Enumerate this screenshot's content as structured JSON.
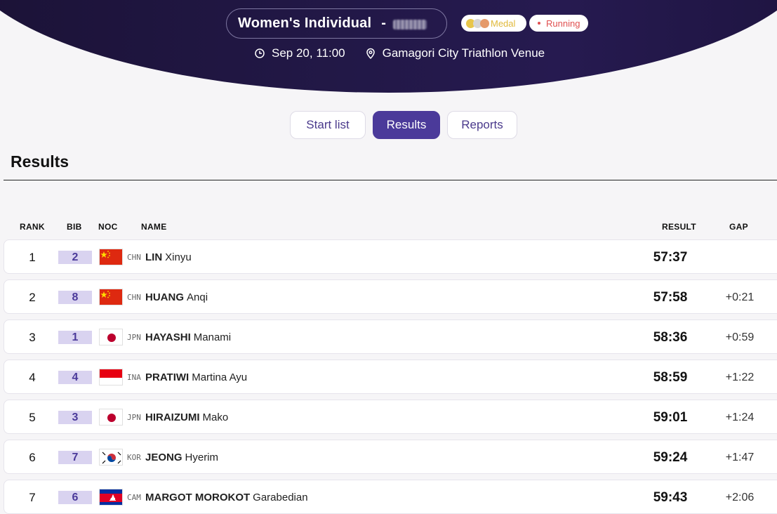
{
  "header": {
    "event_title": "Women's Individual",
    "title_separator": "-",
    "badge_medal": "Medal",
    "badge_running": "Running",
    "datetime": "Sep 20, 11:00",
    "venue": "Gamagori City Triathlon Venue"
  },
  "tabs": [
    {
      "label": "Start list",
      "active": false
    },
    {
      "label": "Results",
      "active": true
    },
    {
      "label": "Reports",
      "active": false
    }
  ],
  "section_title": "Results",
  "columns": {
    "rank": "RANK",
    "bib": "BIB",
    "noc": "NOC",
    "name": "NAME",
    "result": "RESULT",
    "gap": "GAP"
  },
  "rows": [
    {
      "rank": "1",
      "bib": "2",
      "noc": "CHN",
      "last": "LIN",
      "first": "Xinyu",
      "result": "57:37",
      "gap": "",
      "flag": "china-flag-icon"
    },
    {
      "rank": "2",
      "bib": "8",
      "noc": "CHN",
      "last": "HUANG",
      "first": "Anqi",
      "result": "57:58",
      "gap": "+0:21",
      "flag": "china-flag-icon"
    },
    {
      "rank": "3",
      "bib": "1",
      "noc": "JPN",
      "last": "HAYASHI",
      "first": "Manami",
      "result": "58:36",
      "gap": "+0:59",
      "flag": "japan-flag-icon"
    },
    {
      "rank": "4",
      "bib": "4",
      "noc": "INA",
      "last": "PRATIWI",
      "first": "Martina Ayu",
      "result": "58:59",
      "gap": "+1:22",
      "flag": "indonesia-flag-icon"
    },
    {
      "rank": "5",
      "bib": "3",
      "noc": "JPN",
      "last": "HIRAIZUMI",
      "first": "Mako",
      "result": "59:01",
      "gap": "+1:24",
      "flag": "japan-flag-icon"
    },
    {
      "rank": "6",
      "bib": "7",
      "noc": "KOR",
      "last": "JEONG",
      "first": "Hyerim",
      "result": "59:24",
      "gap": "+1:47",
      "flag": "korea-flag-icon"
    },
    {
      "rank": "7",
      "bib": "6",
      "noc": "CAM",
      "last": "MARGOT MOROKOT",
      "first": "Garabedian",
      "result": "59:43",
      "gap": "+2:06",
      "flag": "cambodia-flag-icon"
    }
  ],
  "colors": {
    "header_bg": "#221847",
    "accent": "#4b3a9a",
    "bib_bg": "#d9d3f0",
    "medal_gold": "#e0b93a",
    "running_red": "#e05050"
  }
}
